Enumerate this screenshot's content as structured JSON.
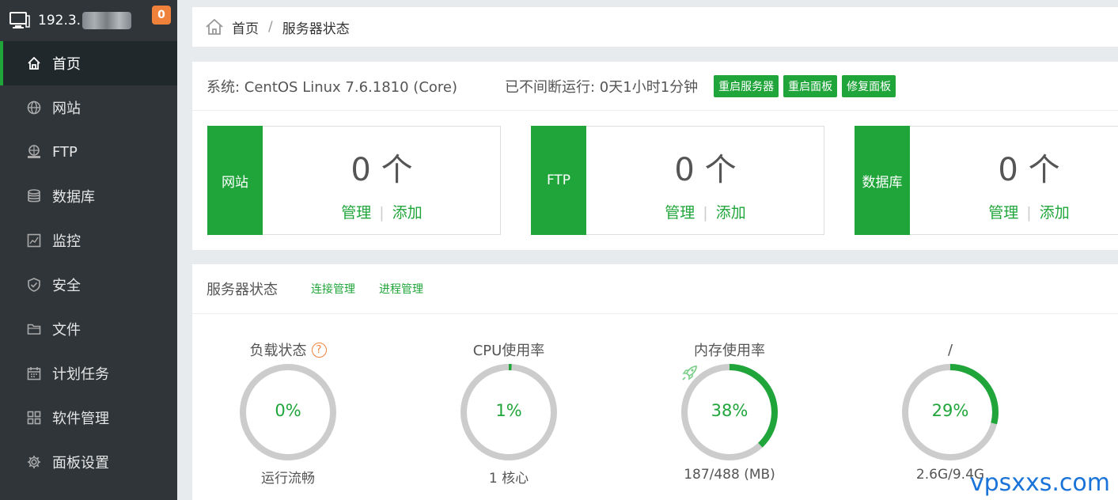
{
  "sidebar": {
    "server_ip": "192.3.",
    "notice_count": "0",
    "items": [
      {
        "label": "首页",
        "icon": "home-icon",
        "active": true
      },
      {
        "label": "网站",
        "icon": "globe-icon"
      },
      {
        "label": "FTP",
        "icon": "ftp-icon"
      },
      {
        "label": "数据库",
        "icon": "database-icon"
      },
      {
        "label": "监控",
        "icon": "monitor-icon"
      },
      {
        "label": "安全",
        "icon": "shield-icon"
      },
      {
        "label": "文件",
        "icon": "folder-icon"
      },
      {
        "label": "计划任务",
        "icon": "calendar-icon"
      },
      {
        "label": "软件管理",
        "icon": "apps-icon"
      },
      {
        "label": "面板设置",
        "icon": "gear-icon"
      }
    ]
  },
  "breadcrumb": {
    "home": "首页",
    "separator": "/",
    "current": "服务器状态"
  },
  "system": {
    "os": "系统: CentOS Linux 7.6.1810 (Core)",
    "uptime": "已不间断运行: 0天1小时1分钟",
    "buttons": [
      "重启服务器",
      "重启面板",
      "修复面板"
    ]
  },
  "stats": [
    {
      "tag": "网站",
      "count": "0 个",
      "manage": "管理",
      "add": "添加"
    },
    {
      "tag": "FTP",
      "count": "0 个",
      "manage": "管理",
      "add": "添加"
    },
    {
      "tag": "数据库",
      "count": "0 个",
      "manage": "管理",
      "add": "添加"
    }
  ],
  "server_status": {
    "title": "服务器状态",
    "links": [
      "连接管理",
      "进程管理"
    ],
    "gauges": [
      {
        "label": "负载状态",
        "value": 0,
        "pct": "0%",
        "sub": "运行流畅",
        "help": "?"
      },
      {
        "label": "CPU使用率",
        "value": 1,
        "pct": "1%",
        "sub": "1 核心"
      },
      {
        "label": "内存使用率",
        "value": 38,
        "pct": "38%",
        "sub": "187/488 (MB)"
      },
      {
        "label": "/",
        "value": 29,
        "pct": "29%",
        "sub": "2.6G/9.4G"
      }
    ]
  },
  "watermark": "vpsxxs.com",
  "colors": {
    "accent": "#20a53a",
    "sidebar_bg": "#2f3539",
    "badge": "#f0813a",
    "ring_track": "#cccccc"
  }
}
